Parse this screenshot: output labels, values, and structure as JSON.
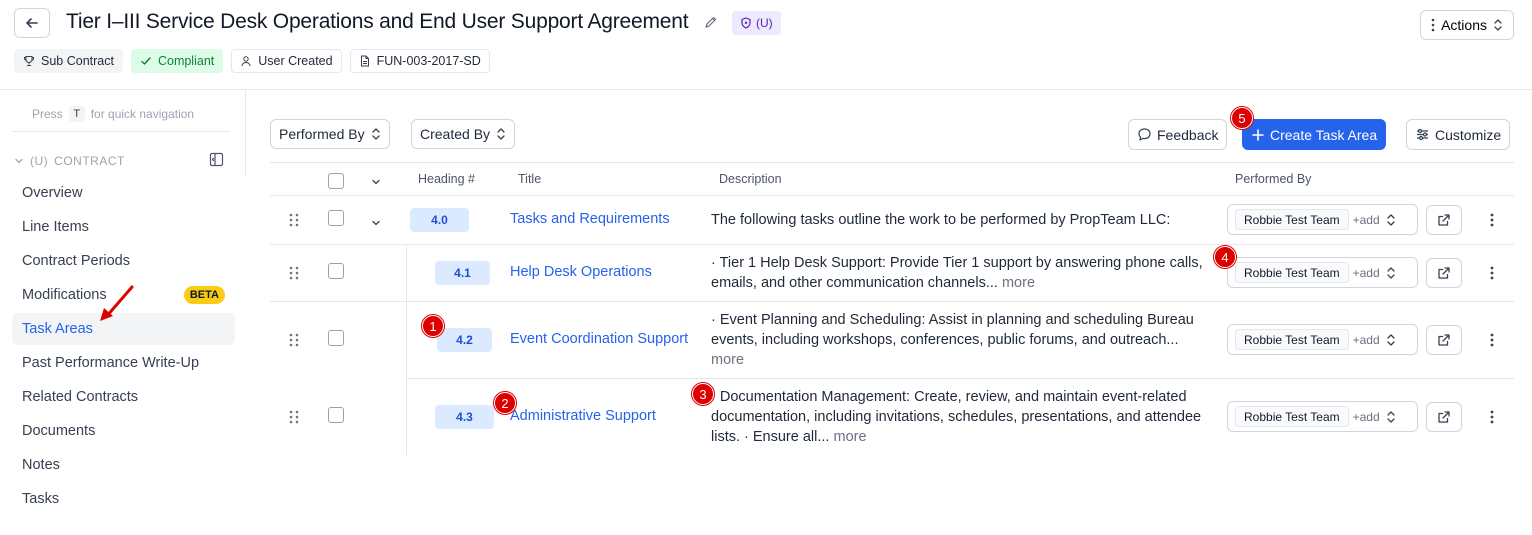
{
  "header": {
    "title": "Tier I–III Service Desk Operations and End User Support Agreement",
    "classification": "(U)",
    "actions_label": "Actions",
    "tags": [
      {
        "label": "Sub Contract",
        "style": "gray",
        "icon": "trophy-icon"
      },
      {
        "label": "Compliant",
        "style": "green",
        "icon": "check-icon"
      },
      {
        "label": "User Created",
        "style": "plain",
        "icon": "user-icon"
      },
      {
        "label": "FUN-003-2017-SD",
        "style": "plain",
        "icon": "document-icon"
      }
    ]
  },
  "sidebar": {
    "quick_nav_press": "Press",
    "quick_nav_key": "T",
    "quick_nav_text": "for quick navigation",
    "section_classification": "(U)",
    "section_title": "CONTRACT",
    "items": [
      {
        "label": "Overview"
      },
      {
        "label": "Line Items"
      },
      {
        "label": "Contract Periods"
      },
      {
        "label": "Modifications",
        "badge": "BETA"
      },
      {
        "label": "Task Areas",
        "active": true
      },
      {
        "label": "Past Performance Write-Up"
      },
      {
        "label": "Related Contracts"
      },
      {
        "label": "Documents"
      },
      {
        "label": "Notes"
      },
      {
        "label": "Tasks"
      }
    ]
  },
  "toolbar": {
    "performed_by_filter": "Performed By",
    "created_by_filter": "Created By",
    "feedback_label": "Feedback",
    "create_label": "Create Task Area",
    "customize_label": "Customize"
  },
  "table": {
    "columns": {
      "heading": "Heading #",
      "title": "Title",
      "description": "Description",
      "performed_by": "Performed By"
    },
    "rows": [
      {
        "heading": "4.0",
        "title": "Tasks and Requirements",
        "description": "The following tasks outline the work to be performed by PropTeam LLC:",
        "more": "",
        "team": "Robbie Test Team",
        "add": "+add"
      },
      {
        "heading": "4.1",
        "title": "Help Desk Operations",
        "description": "· Tier 1 Help Desk Support: Provide Tier 1 support by answering phone calls, emails, and other communication channels...",
        "more": "more",
        "team": "Robbie Test Team",
        "add": "+add"
      },
      {
        "heading": "4.2",
        "title": "Event Coordination Support",
        "description": "· Event Planning and Scheduling: Assist in planning and scheduling Bureau events, including workshops, conferences, public forums, and outreach...",
        "more": "more",
        "team": "Robbie Test Team",
        "add": "+add"
      },
      {
        "heading": "4.3",
        "title": "Administrative Support",
        "description": "· Documentation Management: Create, review, and maintain event-related documentation, including invitations, schedules, presentations, and attendee lists. · Ensure all...",
        "more": "more",
        "team": "Robbie Test Team",
        "add": "+add"
      }
    ]
  },
  "annotations": [
    "1",
    "2",
    "3",
    "4",
    "5"
  ],
  "colors": {
    "accent": "#2563eb",
    "annotation": "#dc0000",
    "beta": "#facc15",
    "compliant_bg": "#dcfce7",
    "classification_bg": "#ede9fe"
  }
}
